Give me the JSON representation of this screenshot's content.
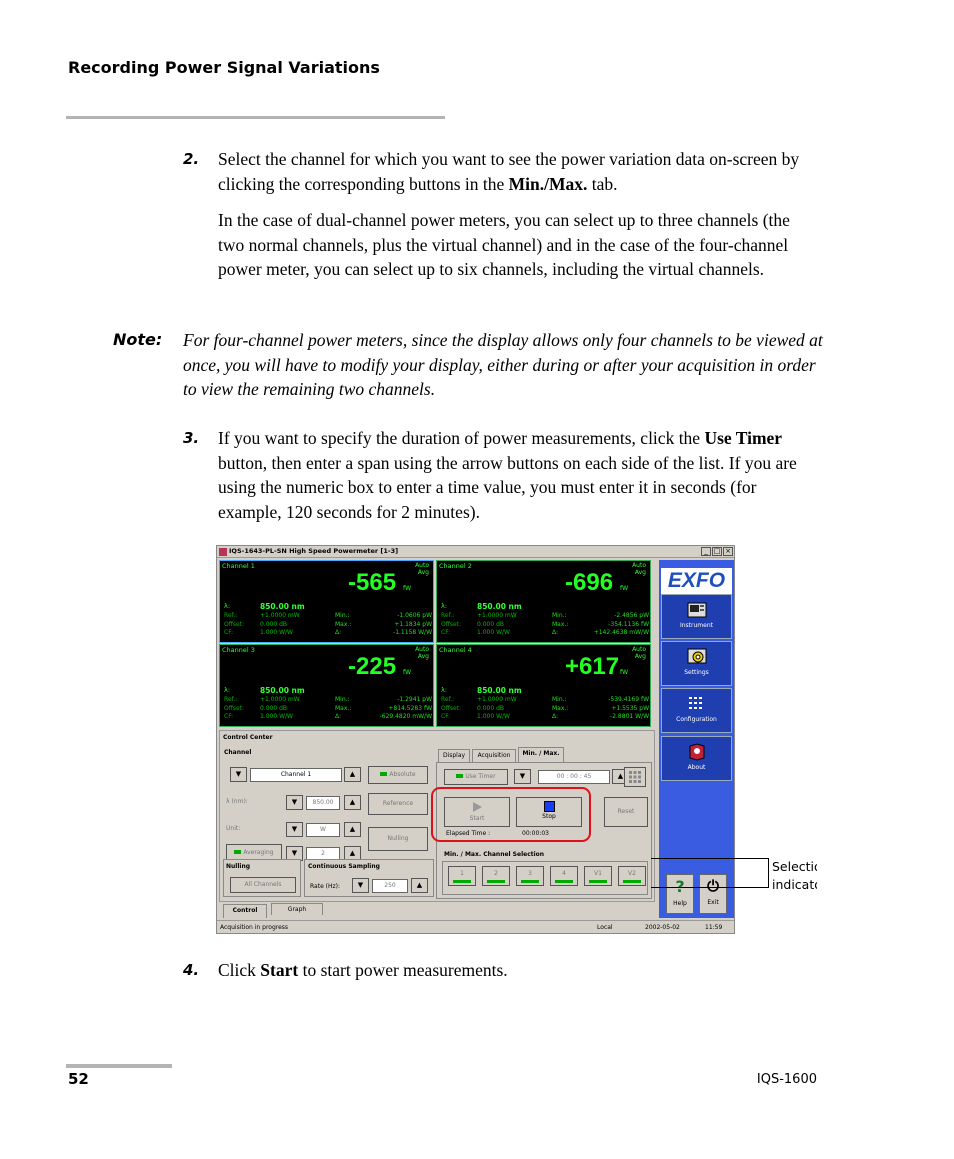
{
  "header": {
    "title": "Recording Power Signal Variations"
  },
  "steps": {
    "s2": {
      "num": "2.",
      "a": "Select the channel for which you want to see the power variation data on-screen by clicking the corresponding buttons in the ",
      "b": "Min./Max.",
      "c": " tab.",
      "p2": "In the case of dual-channel power meters, you can select up to three channels (the two normal channels, plus the virtual channel) and in the case of the four-channel power meter, you can select up to six channels, including the virtual channels."
    },
    "note": {
      "label": "Note:",
      "text": "For four-channel power meters, since the display allows only four channels to be viewed at once, you will have to modify your display, either during or after your acquisition in order to view the remaining two channels."
    },
    "s3": {
      "num": "3.",
      "a": "If you want to specify the duration of power measurements, click the ",
      "b": "Use Timer",
      "c": " button, then enter a span using the arrow buttons on each side of the list. If you are using the numeric box to enter a time value, you must enter it in seconds (for example, 120 seconds for 2 minutes)."
    },
    "s4": {
      "num": "4.",
      "a": "Click ",
      "b": "Start",
      "c": " to start power measurements."
    }
  },
  "screenshot": {
    "title": "IQS-1643-PL-SN High Speed Powermeter [1-3]",
    "win_buttons": [
      "_",
      "□",
      "×"
    ],
    "channels": [
      {
        "name": "Channel 1",
        "auto": "Auto",
        "avg": "Avg",
        "value": "-565",
        "unit": "fW",
        "wl_label": "λ:",
        "wl": "850.00  nm",
        "labels": [
          "Ref.:",
          "Offset:",
          "CF:"
        ],
        "vals": [
          "+1.0000  mW",
          "0.000  dB",
          "1.000  W/W"
        ],
        "mlabels": [
          "Min.:",
          "Max.:",
          "Δ:"
        ],
        "mvals": [
          "-1.0606  pW",
          "+1.1834  pW",
          "-1.1158  W/W"
        ]
      },
      {
        "name": "Channel 2",
        "auto": "Auto",
        "avg": "Avg",
        "value": "-696",
        "unit": "fW",
        "wl_label": "λ:",
        "wl": "850.00  nm",
        "labels": [
          "Ref.:",
          "Offset:",
          "CF:"
        ],
        "vals": [
          "+1.0000  mW",
          "0.000  dB",
          "1.000  W/W"
        ],
        "mlabels": [
          "Min.:",
          "Max.:",
          "Δ:"
        ],
        "mvals": [
          "-2.4856  pW",
          "-354.1136  fW",
          "+142.4638  mW/W"
        ]
      },
      {
        "name": "Channel 3",
        "auto": "Auto",
        "avg": "Avg",
        "value": "-225",
        "unit": "fW",
        "wl_label": "λ:",
        "wl": "850.00  nm",
        "labels": [
          "Ref.:",
          "Offset:",
          "CF:"
        ],
        "vals": [
          "+1.0000  mW",
          "0.000  dB",
          "1.000  W/W"
        ],
        "mlabels": [
          "Min.:",
          "Max.:",
          "Δ:"
        ],
        "mvals": [
          "-1.2941  pW",
          "+814.5283  fW",
          "-629.4820  mW/W"
        ]
      },
      {
        "name": "Channel 4",
        "auto": "Auto",
        "avg": "Avg",
        "value": "+617",
        "unit": "fW",
        "wl_label": "λ:",
        "wl": "850.00  nm",
        "labels": [
          "Ref.:",
          "Offset:",
          "CF:"
        ],
        "vals": [
          "+1.0000  mW",
          "0.000  dB",
          "1.000  W/W"
        ],
        "mlabels": [
          "Min.:",
          "Max.:",
          "Δ:"
        ],
        "mvals": [
          "-539.4169  fW",
          "+1.5535  pW",
          "-2.8801  W/W"
        ]
      }
    ],
    "side": {
      "logo": "EXFO",
      "instrument": "Instrument",
      "settings": "Settings",
      "configuration": "Configuration",
      "about": "About",
      "help": "Help",
      "exit": "Exit",
      "help_glyph": "?",
      "exit_glyph": "⏻"
    },
    "control": {
      "title": "Control Center",
      "channel_label": "Channel",
      "channel_value": "Channel 1",
      "absolute": "Absolute",
      "wl_label": "λ (nm):",
      "wl_value": "850.00",
      "reference": "Reference",
      "unit_label": "Unit:",
      "unit_value": "W",
      "averaging": "Averaging",
      "avg_value": "2",
      "nulling_btn": "Nulling",
      "nulling_label": "Nulling",
      "all_channels": "All Channels",
      "cont_label": "Continuous Sampling",
      "rate_label": "Rate (Hz):",
      "rate_value": "250",
      "tabs": [
        "Display",
        "Acquisition",
        "Min. / Max."
      ],
      "use_timer": "Use Timer",
      "timer_value": "00 : 00 : 45",
      "start": "Start",
      "stop": "Stop",
      "reset": "Reset",
      "elapsed_label": "Elapsed Time :",
      "elapsed_value": "00:00:03",
      "selection_title": "Min. / Max. Channel Selection",
      "sel_buttons": [
        "1",
        "2",
        "3",
        "4",
        "V1",
        "V2"
      ],
      "bottom_tabs": [
        "Control",
        "Graph"
      ],
      "down": "▼",
      "up": "▲"
    },
    "status": {
      "left": "Acquisition in progress",
      "mode": "Local",
      "date": "2002-05-02",
      "time": "11:59"
    }
  },
  "callout": {
    "line1": "Selection",
    "line2": "indicator"
  },
  "footer": {
    "page": "52",
    "product": "IQS-1600"
  }
}
